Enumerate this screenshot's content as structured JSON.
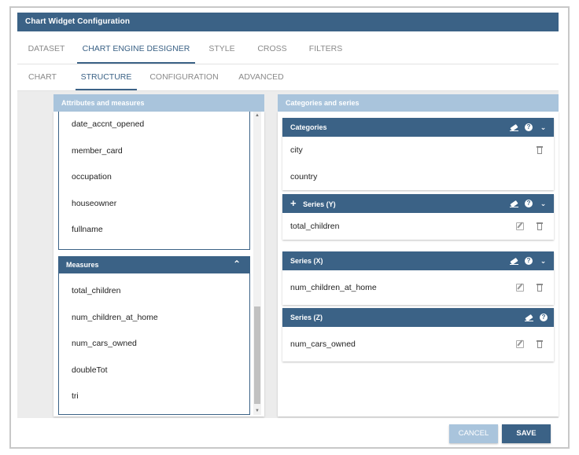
{
  "window": {
    "title": "Chart Widget Configuration"
  },
  "tabs_main": [
    {
      "label": "DATASET",
      "active": false
    },
    {
      "label": "CHART ENGINE DESIGNER",
      "active": true
    },
    {
      "label": "STYLE",
      "active": false
    },
    {
      "label": "CROSS",
      "active": false
    },
    {
      "label": "FILTERS",
      "active": false
    }
  ],
  "tabs_sub": [
    {
      "label": "CHART",
      "active": false
    },
    {
      "label": "STRUCTURE",
      "active": true
    },
    {
      "label": "CONFIGURATION",
      "active": false
    },
    {
      "label": "ADVANCED",
      "active": false
    }
  ],
  "left_panel": {
    "header": "Attributes and measures",
    "attributes": [
      "date_accnt_opened",
      "member_card",
      "occupation",
      "houseowner",
      "fullname"
    ],
    "measures_header": "Measures",
    "measures": [
      "total_children",
      "num_children_at_home",
      "num_cars_owned",
      "doubleTot",
      "tri"
    ]
  },
  "right_panel": {
    "header": "Categories and series",
    "categories": {
      "title": "Categories",
      "items": [
        "city",
        "country"
      ]
    },
    "series_y": {
      "title": "Series (Y)",
      "items": [
        "total_children"
      ]
    },
    "series_x": {
      "title": "Series (X)",
      "items": [
        "num_children_at_home"
      ]
    },
    "series_z": {
      "title": "Series (Z)",
      "items": [
        "num_cars_owned"
      ]
    }
  },
  "footer": {
    "cancel_label": "CANCEL",
    "save_label": "SAVE"
  },
  "colors": {
    "primary": "#3b6286",
    "light": "#a9c4dc",
    "panel_bg": "#ececec"
  }
}
